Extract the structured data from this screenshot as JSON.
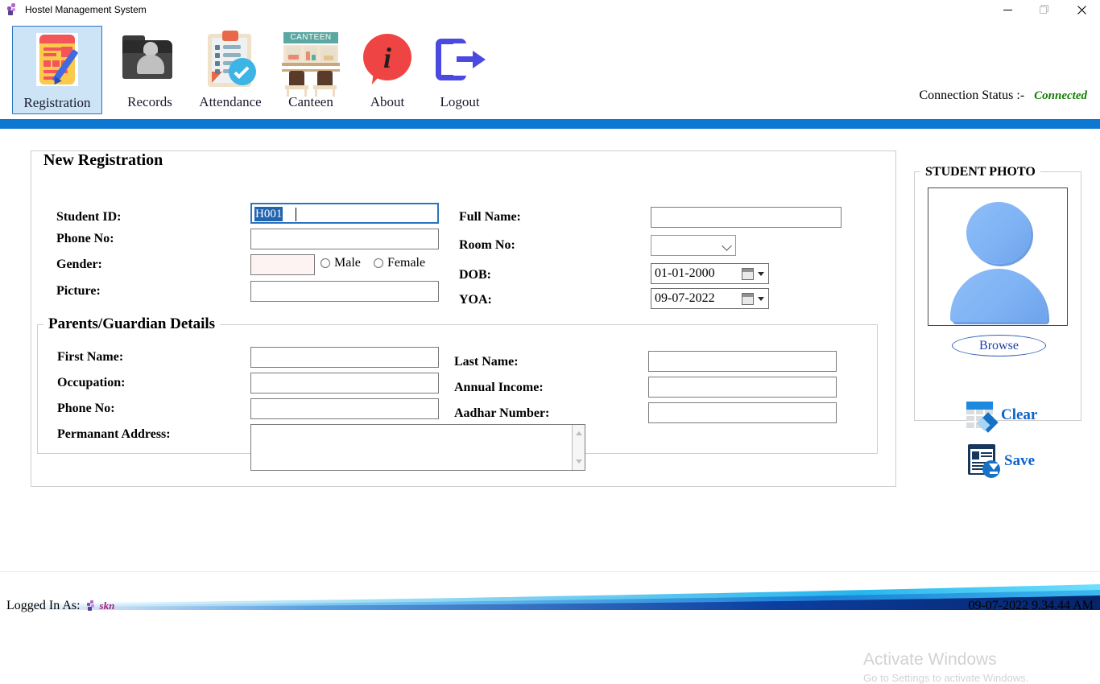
{
  "window": {
    "title": "Hostel Management System",
    "app_icon": "app-icon",
    "minimize": "minimize-icon",
    "maximize": "maximize-icon",
    "close": "close-icon"
  },
  "toolbar": {
    "items": [
      {
        "label": "Registration",
        "icon": "registration-icon",
        "selected": true
      },
      {
        "label": "Records",
        "icon": "records-folder-icon",
        "selected": false
      },
      {
        "label": "Attendance",
        "icon": "attendance-clipboard-icon",
        "selected": false
      },
      {
        "label": "Canteen",
        "icon": "canteen-icon",
        "selected": false,
        "sign": "CANTEEN"
      },
      {
        "label": "About",
        "icon": "about-info-icon",
        "selected": false
      },
      {
        "label": "Logout",
        "icon": "logout-icon",
        "selected": false
      }
    ],
    "connection_label": "Connection Status :-",
    "connection_value": "Connected",
    "connection_color": "#128000"
  },
  "form": {
    "new_registration_legend": "New Registration",
    "parents_legend": "Parents/Guardian Details",
    "labels": {
      "student_id": "Student ID:",
      "phone_no": "Phone No:",
      "gender": "Gender:",
      "picture": "Picture:",
      "full_name": "Full Name:",
      "room_no": "Room No:",
      "dob": "DOB:",
      "yoa": "YOA:",
      "first_name": "First Name:",
      "occupation": "Occupation:",
      "parent_phone_no": "Phone No:",
      "permanent_address": "Permanant Address:",
      "last_name": "Last Name:",
      "annual_income": "Annual Income:",
      "aadhar_number": "Aadhar Number:"
    },
    "values": {
      "student_id": "H001",
      "student_id_selected": true,
      "phone_no": "",
      "gender": "",
      "picture": "",
      "full_name": "",
      "room_no": "",
      "dob": "01-01-2000",
      "yoa": "09-07-2022",
      "first_name": "",
      "occupation": "",
      "parent_phone_no": "",
      "permanent_address": "",
      "last_name": "",
      "annual_income": "",
      "aadhar_number": ""
    },
    "radios": {
      "male": "Male",
      "female": "Female",
      "male_checked": false,
      "female_checked": false
    }
  },
  "photo": {
    "legend": "STUDENT PHOTO",
    "avatar_icon": "default-avatar-icon",
    "browse_label": "Browse"
  },
  "actions": {
    "clear_label": "Clear",
    "clear_icon": "clear-eraser-icon",
    "save_label": "Save",
    "save_icon": "save-download-icon",
    "accent_color": "#0f62c8"
  },
  "watermark": {
    "line1": "Activate Windows",
    "line2": "Go to Settings to activate Windows."
  },
  "statusbar": {
    "logged_in_label": "Logged In As:",
    "user_icon": "user-icon",
    "username": "skn",
    "datetime": "09-07-2022 9.34.44 AM"
  }
}
